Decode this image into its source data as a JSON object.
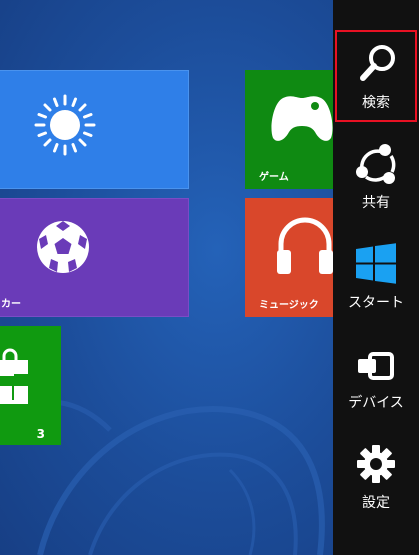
{
  "tiles": {
    "weather": {
      "label": ""
    },
    "soccer": {
      "label": "カー"
    },
    "game": {
      "label": "ゲーム"
    },
    "music": {
      "label": "ミュージック"
    },
    "store": {
      "label": "",
      "badge": "3"
    }
  },
  "charms": {
    "search": {
      "label": "検索",
      "icon": "search-icon",
      "selected": true
    },
    "share": {
      "label": "共有",
      "icon": "share-icon"
    },
    "start": {
      "label": "スタート",
      "icon": "windows-logo-icon"
    },
    "devices": {
      "label": "デバイス",
      "icon": "devices-icon"
    },
    "settings": {
      "label": "設定",
      "icon": "gear-icon"
    }
  },
  "colors": {
    "background": "#1d4f9c",
    "charm_bar": "#111111",
    "selection": "#e81123",
    "weather_tile": "#2f7fe8",
    "soccer_tile": "#6a3bb8",
    "game_tile": "#0f8a12",
    "music_tile": "#d9472b",
    "store_tile": "#109a10",
    "windows_logo": "#1aa1f2"
  }
}
